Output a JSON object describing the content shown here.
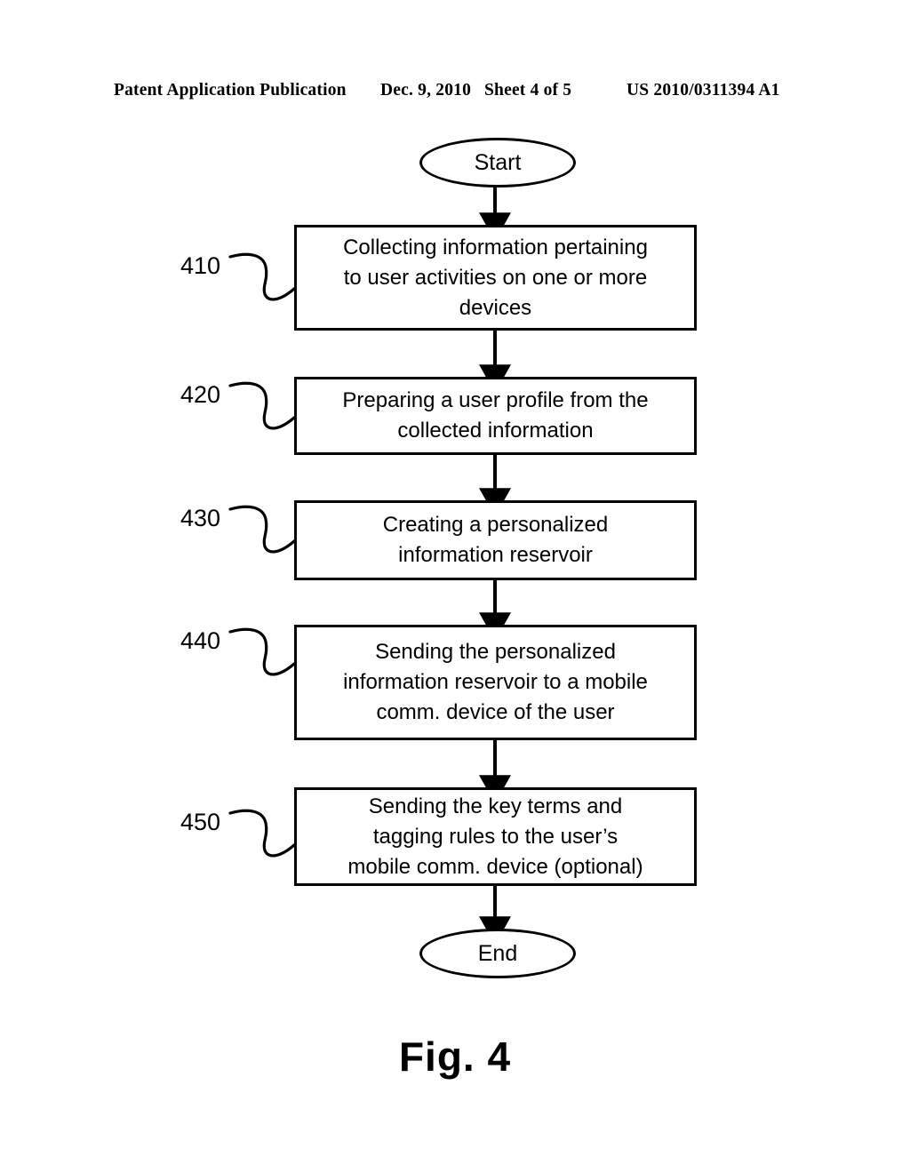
{
  "header": {
    "publication": "Patent Application Publication",
    "date": "Dec. 9, 2010",
    "sheet": "Sheet 4 of 5",
    "patent_number": "US 2010/0311394 A1"
  },
  "figure": {
    "caption": "Fig. 4",
    "type": "process-flowchart"
  },
  "flowchart": {
    "start": {
      "label": "Start",
      "shape": "ellipse"
    },
    "end": {
      "label": "End",
      "shape": "ellipse"
    },
    "steps": [
      {
        "ref": "410",
        "text": "Collecting information pertaining\nto user activities on one or more\ndevices",
        "shape": "rectangle"
      },
      {
        "ref": "420",
        "text": "Preparing a user profile from the\ncollected information",
        "shape": "rectangle"
      },
      {
        "ref": "430",
        "text": "Creating a personalized\ninformation reservoir",
        "shape": "rectangle"
      },
      {
        "ref": "440",
        "text": "Sending the personalized\ninformation reservoir to a mobile\ncomm. device of the user",
        "shape": "rectangle"
      },
      {
        "ref": "450",
        "text": "Sending the key terms and\ntagging rules to the user’s\nmobile comm. device (optional)",
        "shape": "rectangle"
      }
    ],
    "colors": {
      "stroke": "#000000",
      "fill": "#ffffff",
      "text": "#000000"
    }
  }
}
